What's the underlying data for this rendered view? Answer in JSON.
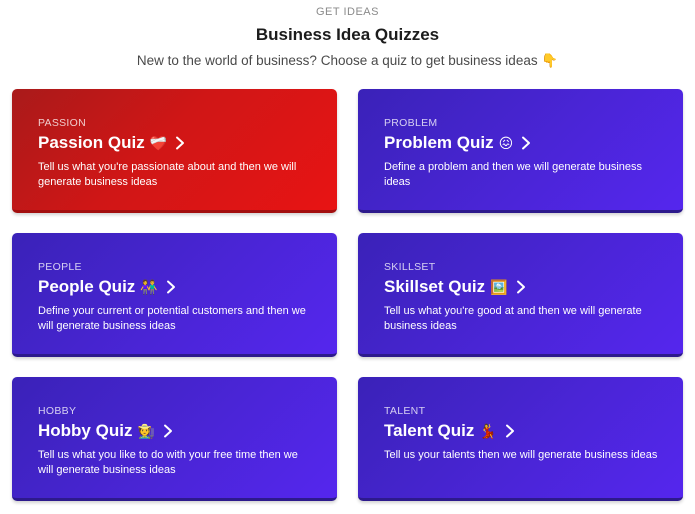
{
  "header": {
    "eyebrow": "GET IDEAS",
    "title": "Business Idea Quizzes",
    "subtitle": "New to the world of business? Choose a quiz to get business ideas 👇"
  },
  "quizzes": [
    {
      "tag": "PASSION",
      "title": "Passion Quiz",
      "emoji": "❤️‍🩹",
      "icon": "mending-heart-icon",
      "description": "Tell us what you're passionate about and then we will generate business ideas",
      "style": "red",
      "accent": "#d01616"
    },
    {
      "tag": "PROBLEM",
      "title": "Problem Quiz",
      "emoji": "😖",
      "icon": "confounded-face-icon",
      "description": "Define a problem and then we will generate business ideas",
      "style": "blue",
      "accent": "#4a25d6"
    },
    {
      "tag": "PEOPLE",
      "title": "People Quiz",
      "emoji": "👫",
      "icon": "people-holding-hands-icon",
      "description": "Define your current or potential customers and then we will generate business ideas",
      "style": "blue",
      "accent": "#4a25d6"
    },
    {
      "tag": "SKILLSET",
      "title": "Skillset Quiz",
      "emoji": "🖼️",
      "icon": "framed-picture-icon",
      "description": "Tell us what you're good at and then we will generate business ideas",
      "style": "blue",
      "accent": "#4a25d6"
    },
    {
      "tag": "HOBBY",
      "title": "Hobby Quiz",
      "emoji": "🧑‍🌾",
      "icon": "farmer-icon",
      "description": "Tell us what you like to do with your free time then we will generate business ideas",
      "style": "blue",
      "accent": "#4a25d6"
    },
    {
      "tag": "TALENT",
      "title": "Talent Quiz",
      "emoji": "💃",
      "icon": "dancer-icon",
      "description": "Tell us your talents then we will generate business ideas",
      "style": "blue",
      "accent": "#4a25d6"
    }
  ]
}
